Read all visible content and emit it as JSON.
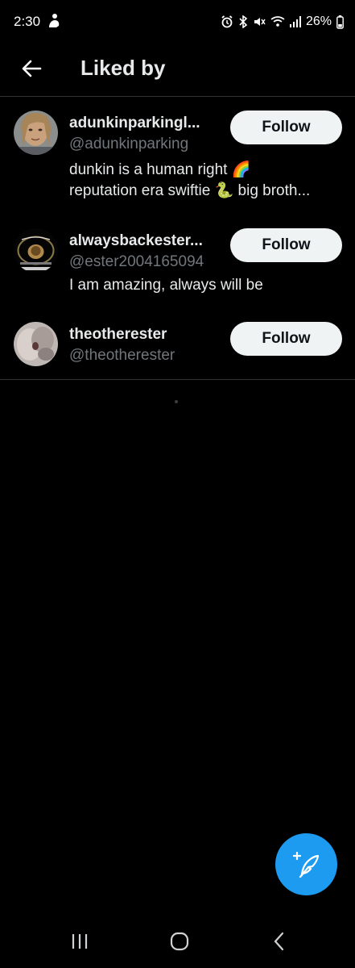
{
  "status_bar": {
    "time": "2:30",
    "battery": "26%"
  },
  "header": {
    "title": "Liked by"
  },
  "users": [
    {
      "name": "adunkinparkingl...",
      "handle": "@adunkinparking",
      "bio_lines": [
        "dunkin is a human right 🌈",
        "reputation era swiftie 🐍 big broth..."
      ],
      "follow_label": "Follow"
    },
    {
      "name": "alwaysbackester...",
      "handle": "@ester2004165094",
      "bio_lines": [
        "I am amazing, always will be"
      ],
      "follow_label": "Follow"
    },
    {
      "name": "theotherester",
      "handle": "@theotherester",
      "bio_lines": [],
      "follow_label": "Follow"
    }
  ],
  "colors": {
    "background": "#000000",
    "accent": "#1d9bf0",
    "divider": "#2f3336",
    "secondary_text": "#71767b"
  }
}
